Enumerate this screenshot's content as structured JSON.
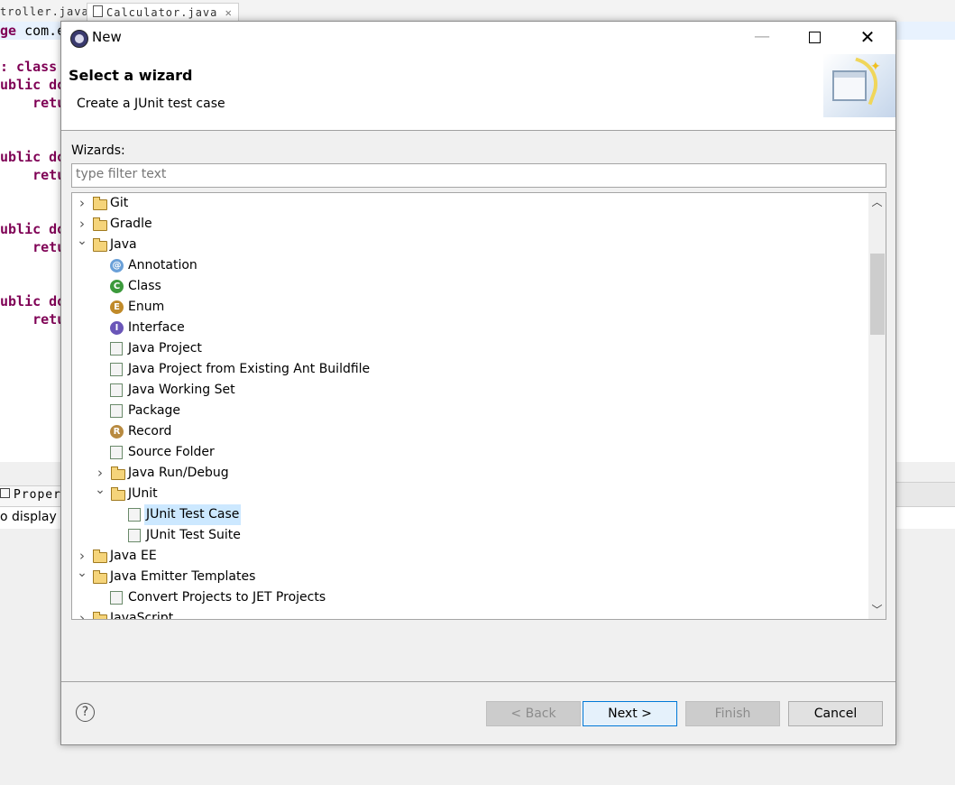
{
  "editor": {
    "tabs": [
      "troller.java",
      "Calculator.java"
    ],
    "lines": [
      {
        "kw": "ge",
        "text": " com.e"
      },
      {
        "kw": "",
        "text": ""
      },
      {
        "kw": ": class ",
        "text": ""
      },
      {
        "kw": "ublic do",
        "text": ""
      },
      {
        "kw": "    retur",
        "text": ""
      },
      {
        "kw": "",
        "text": ""
      },
      {
        "kw": "",
        "text": ""
      },
      {
        "kw": "ublic do",
        "text": ""
      },
      {
        "kw": "    retur",
        "text": ""
      },
      {
        "kw": "",
        "text": ""
      },
      {
        "kw": "",
        "text": ""
      },
      {
        "kw": "ublic do",
        "text": ""
      },
      {
        "kw": "    retur",
        "text": ""
      },
      {
        "kw": "",
        "text": ""
      },
      {
        "kw": "",
        "text": ""
      },
      {
        "kw": "ublic do",
        "text": ""
      },
      {
        "kw": "    retur",
        "text": ""
      }
    ]
  },
  "bottom_pane": {
    "tab_label": "Propert",
    "body_text": "o display "
  },
  "dialog": {
    "title": "New",
    "header_title": "Select a wizard",
    "header_desc": "Create a JUnit test case",
    "wizards_label": "Wizards:",
    "filter_placeholder": "type filter text",
    "tree": [
      {
        "label": "Git",
        "level": 0,
        "chevron": "collapsed",
        "icon": "folder-icon"
      },
      {
        "label": "Gradle",
        "level": 0,
        "chevron": "collapsed",
        "icon": "folder-icon"
      },
      {
        "label": "Java",
        "level": 0,
        "chevron": "expanded",
        "icon": "folder-icon"
      },
      {
        "label": "Annotation",
        "level": 1,
        "chevron": "none",
        "icon": "annotation-icon"
      },
      {
        "label": "Class",
        "level": 1,
        "chevron": "none",
        "icon": "class-icon"
      },
      {
        "label": "Enum",
        "level": 1,
        "chevron": "none",
        "icon": "enum-icon"
      },
      {
        "label": "Interface",
        "level": 1,
        "chevron": "none",
        "icon": "interface-icon"
      },
      {
        "label": "Java Project",
        "level": 1,
        "chevron": "none",
        "icon": "java-project-icon"
      },
      {
        "label": "Java Project from Existing Ant Buildfile",
        "level": 1,
        "chevron": "none",
        "icon": "ant-icon"
      },
      {
        "label": "Java Working Set",
        "level": 1,
        "chevron": "none",
        "icon": "working-set-icon"
      },
      {
        "label": "Package",
        "level": 1,
        "chevron": "none",
        "icon": "package-icon"
      },
      {
        "label": "Record",
        "level": 1,
        "chevron": "none",
        "icon": "record-icon"
      },
      {
        "label": "Source Folder",
        "level": 1,
        "chevron": "none",
        "icon": "source-folder-icon"
      },
      {
        "label": "Java Run/Debug",
        "level": 1,
        "chevron": "collapsed",
        "icon": "folder-icon"
      },
      {
        "label": "JUnit",
        "level": 1,
        "chevron": "expanded",
        "icon": "folder-icon"
      },
      {
        "label": "JUnit Test Case",
        "level": 2,
        "chevron": "none",
        "icon": "junit-test-case-icon",
        "selected": true
      },
      {
        "label": "JUnit Test Suite",
        "level": 2,
        "chevron": "none",
        "icon": "junit-test-suite-icon"
      },
      {
        "label": "Java EE",
        "level": 0,
        "chevron": "collapsed",
        "icon": "folder-icon"
      },
      {
        "label": "Java Emitter Templates",
        "level": 0,
        "chevron": "expanded",
        "icon": "folder-icon"
      },
      {
        "label": "Convert Projects to JET Projects",
        "level": 1,
        "chevron": "none",
        "icon": "convert-icon"
      },
      {
        "label": "JavaScript",
        "level": 0,
        "chevron": "collapsed",
        "icon": "folder-icon"
      }
    ],
    "buttons": {
      "back": "< Back",
      "next": "Next >",
      "finish": "Finish",
      "cancel": "Cancel"
    },
    "help_glyph": "?"
  }
}
